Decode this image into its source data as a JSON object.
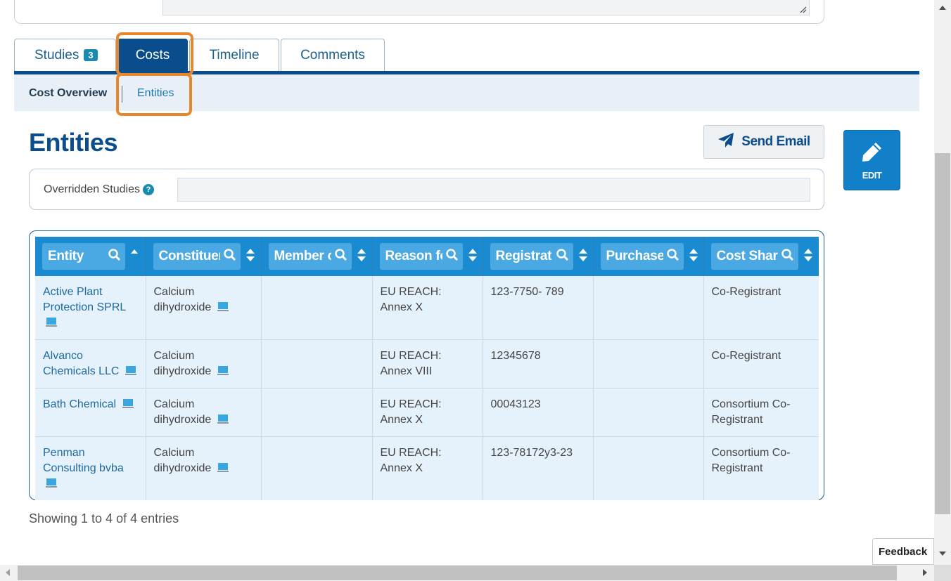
{
  "tabs": [
    {
      "label": "Studies",
      "badge": "3"
    },
    {
      "label": "Costs"
    },
    {
      "label": "Timeline"
    },
    {
      "label": "Comments"
    }
  ],
  "subnav": {
    "overview": "Cost Overview",
    "entities": "Entities"
  },
  "heading": "Entities",
  "buttons": {
    "send_email": "Send Email",
    "edit": "EDIT"
  },
  "overridden": {
    "label": "Overridden Studies",
    "help": "?",
    "value": ""
  },
  "table": {
    "columns": [
      "Entity",
      "Constituen",
      "Member o",
      "Reason fo",
      "Registrat",
      "Purchase",
      "Cost Shari"
    ],
    "rows": [
      {
        "entity": "Active Plant Protection SPRL",
        "constituent": "Calcium dihydroxide",
        "member": "",
        "reason": "EU REACH: Annex X",
        "registration": "123-7750- 789",
        "purchase": "",
        "cost_sharing": "Co-Registrant"
      },
      {
        "entity": "Alvanco Chemicals LLC",
        "constituent": "Calcium dihydroxide",
        "member": "",
        "reason": "EU REACH: Annex VIII",
        "registration": "12345678",
        "purchase": "",
        "cost_sharing": "Co-Registrant"
      },
      {
        "entity": "Bath Chemical",
        "constituent": "Calcium dihydroxide",
        "member": "",
        "reason": "EU REACH: Annex X",
        "registration": "00043123",
        "purchase": "",
        "cost_sharing": "Consortium Co-Registrant"
      },
      {
        "entity": "Penman Consulting bvba",
        "constituent": "Calcium dihydroxide",
        "member": "",
        "reason": "EU REACH: Annex X",
        "registration": "123-78172y3-23",
        "purchase": "",
        "cost_sharing": "Consortium Co-Registrant"
      }
    ]
  },
  "footer": {
    "showing": "Showing 1 to 4 of 4 entries",
    "feedback": "Feedback"
  },
  "colors": {
    "primary": "#0a4d8c",
    "header": "#1a8bd0",
    "highlight": "#e8862a",
    "row_bg": "#e5f1fb"
  },
  "icons": [
    "search-icon",
    "sort-icon",
    "computer-icon",
    "paper-plane-icon",
    "pencil-icon",
    "help-icon",
    "resize-grip-icon"
  ]
}
